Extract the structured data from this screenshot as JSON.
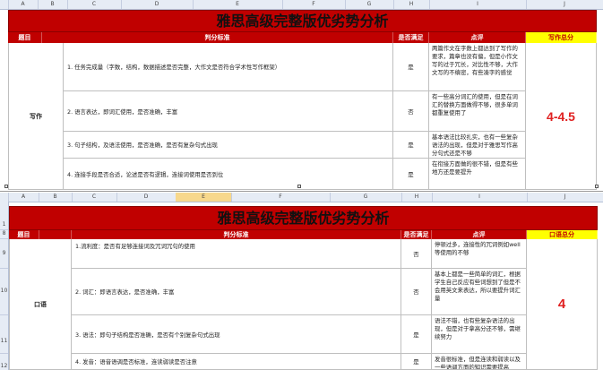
{
  "top": {
    "columns": [
      "A",
      "B",
      "C",
      "D",
      "E",
      "F",
      "G",
      "H",
      "I",
      "J"
    ],
    "title": "雅思高级完整版优劣势分析",
    "headers": {
      "item": "题目",
      "criteria": "判分标准",
      "met": "是否满足",
      "comment": "点评",
      "total": "写作总分"
    },
    "category": "写作",
    "score": "4-4.5",
    "rows": [
      {
        "criteria": "1. 任务完成量（字数，结构，数据描述是否完整，大作文是否符合学术性写作框架）",
        "met": "是",
        "comment": "两篇作文在字数上都达到了写作的要求，篇章也没有偏，但是小作文写的过于冗长，对比性不够，大作文写的不缜密，有些凑字的感觉"
      },
      {
        "criteria": "2. 语言表达，即词汇使用，是否准确，丰富",
        "met": "否",
        "comment": "有一些高分词汇的使用，但是在词汇的替换方面做得不够，很多单词都重复使用了"
      },
      {
        "criteria": "3. 句子结构，及语法使用，是否准确，是否有复杂句式出现",
        "met": "是",
        "comment": "基本语法比较扎实，也有一些复杂语法的出现，但是对于雅思写作高分句式还是不够"
      },
      {
        "criteria": "4. 连接手段是否合适，论述是否有逻辑，连接词使用是否到位",
        "met": "是",
        "comment": "在衔接方面做的很不错，但是有些地方还是要提升"
      }
    ]
  },
  "bottom": {
    "columns": [
      "A",
      "B",
      "C",
      "D",
      "E",
      "F",
      "G",
      "H",
      "I",
      "J"
    ],
    "row_numbers": [
      "1",
      "8",
      "9",
      "10",
      "11",
      "12"
    ],
    "title": "雅思高级完整版优劣势分析",
    "headers": {
      "item": "题目",
      "criteria": "判分标准",
      "met": "是否满足",
      "comment": "点评",
      "total": "口语总分"
    },
    "category": "口语",
    "score": "4",
    "rows": [
      {
        "criteria": "1.流利度：是否有足够连接词及冗词冗句的使用",
        "met": "否",
        "comment": "停顿过多，连接性的冗词例如well等使用的不够"
      },
      {
        "criteria": "2. 词汇：即语言表达，是否准确，丰富",
        "met": "否",
        "comment": "基本上都是一些简单的词汇，根据学生自己反应有些词想到了但是不会用英文来表达，所以要提升词汇量"
      },
      {
        "criteria": "3. 语法：即句子结构是否准确，是否有个别复杂句式出现",
        "met": "是",
        "comment": "语法不错，也有些复杂语法的出现，但是对于拿高分还不够，需继续努力"
      },
      {
        "criteria": "4. 发音：语音语调是否标准，连读弱读是否注意",
        "met": "是",
        "comment": "发音很标准，但是连读和弱读以及一些语调方面的知识需要提高"
      }
    ]
  }
}
